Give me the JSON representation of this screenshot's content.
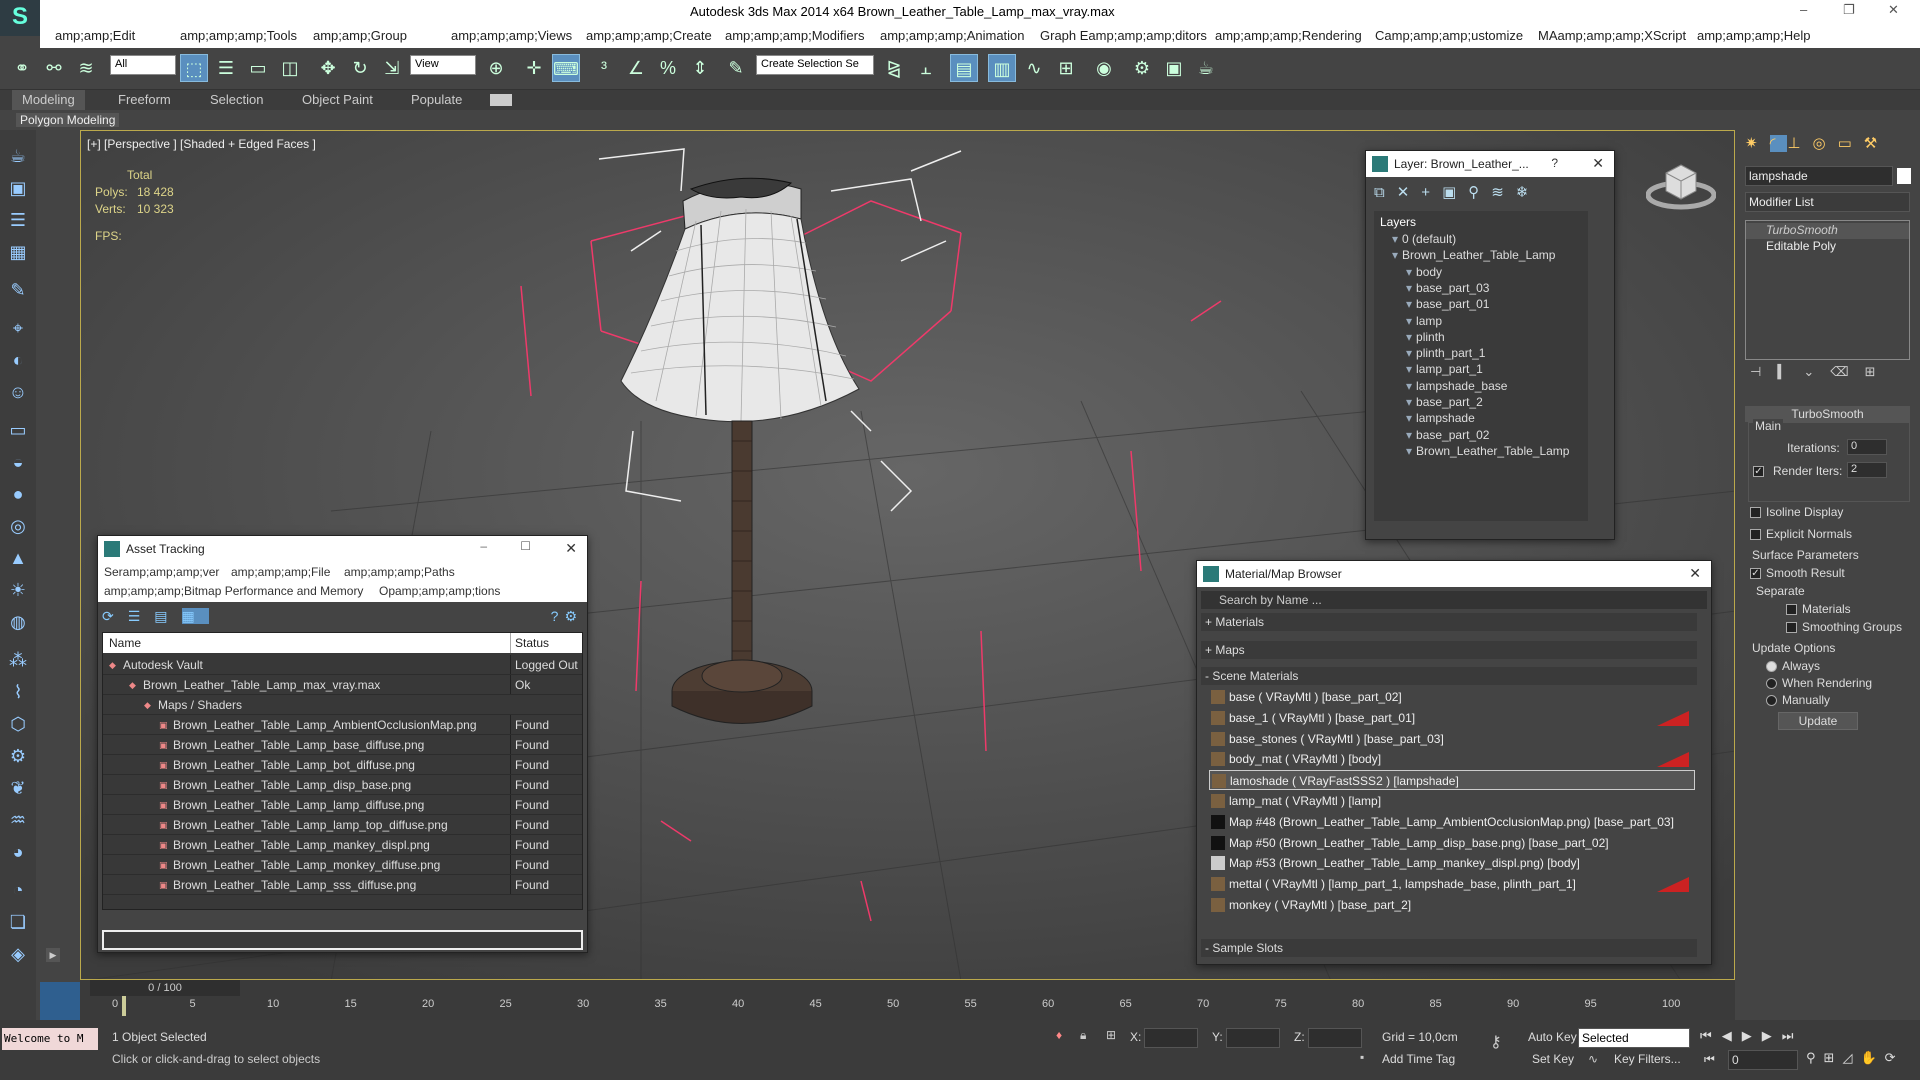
{
  "title": "Autodesk 3ds Max  2014 x64     Brown_Leather_Table_Lamp_max_vray.max",
  "menu": [
    "amp;amp;Edit",
    "amp;amp;amp;Tools",
    "amp;amp;Group",
    "amp;amp;amp;Views",
    "amp;amp;amp;Create",
    "amp;amp;amp;Modifiers",
    "amp;amp;amp;Animation",
    "Graph Eamp;amp;amp;ditors",
    "amp;amp;amp;Rendering",
    "Camp;amp;amp;ustomize",
    "MAamp;amp;amp;XScript",
    "amp;amp;amp;Help"
  ],
  "toolbar": {
    "filter_value": "All",
    "refcoord_value": "View",
    "selection_set_placeholder": "Create Selection Se"
  },
  "ribbon_tabs": [
    "Modeling",
    "Freeform",
    "Selection",
    "Object Paint",
    "Populate"
  ],
  "ribbon_sub": "Polygon Modeling",
  "viewport": {
    "label": "[+] [Perspective ] [Shaded + Edged Faces ]",
    "stats_total": "Total",
    "polys_label": "Polys:",
    "polys_value": "18 428",
    "verts_label": "Verts:",
    "verts_value": "10 323",
    "fps_label": "FPS:"
  },
  "layer_window": {
    "title": "Layer: Brown_Leather_...",
    "help": "?",
    "header": "Layers",
    "items": [
      "0 (default)",
      "Brown_Leather_Table_Lamp",
      "body",
      "base_part_03",
      "base_part_01",
      "lamp",
      "plinth",
      "plinth_part_1",
      "lamp_part_1",
      "lampshade_base",
      "base_part_2",
      "lampshade",
      "base_part_02",
      "Brown_Leather_Table_Lamp"
    ]
  },
  "asset_window": {
    "title": "Asset Tracking",
    "menu": [
      "Seramp;amp;amp;ver",
      "amp;amp;amp;File",
      "amp;amp;amp;Paths",
      "amp;amp;amp;Bitmap Performance and Memory",
      "Opamp;amp;amp;tions"
    ],
    "col_name": "Name",
    "col_status": "Status",
    "rows": [
      {
        "name": "Autodesk Vault",
        "status": "Logged Out ..."
      },
      {
        "name": "Brown_Leather_Table_Lamp_max_vray.max",
        "status": "Ok"
      },
      {
        "name": "Maps / Shaders",
        "status": ""
      },
      {
        "name": "Brown_Leather_Table_Lamp_AmbientOcclusionMap.png",
        "status": "Found"
      },
      {
        "name": "Brown_Leather_Table_Lamp_base_diffuse.png",
        "status": "Found"
      },
      {
        "name": "Brown_Leather_Table_Lamp_bot_diffuse.png",
        "status": "Found"
      },
      {
        "name": "Brown_Leather_Table_Lamp_disp_base.png",
        "status": "Found"
      },
      {
        "name": "Brown_Leather_Table_Lamp_lamp_diffuse.png",
        "status": "Found"
      },
      {
        "name": "Brown_Leather_Table_Lamp_lamp_top_diffuse.png",
        "status": "Found"
      },
      {
        "name": "Brown_Leather_Table_Lamp_mankey_displ.png",
        "status": "Found"
      },
      {
        "name": "Brown_Leather_Table_Lamp_monkey_diffuse.png",
        "status": "Found"
      },
      {
        "name": "Brown_Leather_Table_Lamp_sss_diffuse.png",
        "status": "Found"
      }
    ]
  },
  "material_browser": {
    "title": "Material/Map Browser",
    "search_placeholder": "Search by Name ...",
    "materials_label": "+ Materials",
    "maps_label": "+ Maps",
    "scene_label": "- Scene Materials",
    "sample_label": "- Sample Slots",
    "items": [
      {
        "text": "base  ( VRayMtl ) [base_part_02]",
        "red": false
      },
      {
        "text": "base_1  ( VRayMtl ) [base_part_01]",
        "red": true
      },
      {
        "text": "base_stones  ( VRayMtl ) [base_part_03]",
        "red": false
      },
      {
        "text": "body_mat  ( VRayMtl ) [body]",
        "red": true
      },
      {
        "text": "lamoshade  ( VRayFastSSS2 ) [lampshade]",
        "red": false
      },
      {
        "text": "lamp_mat  ( VRayMtl ) [lamp]",
        "red": false
      },
      {
        "text": "Map #48 (Brown_Leather_Table_Lamp_AmbientOcclusionMap.png) [base_part_03]",
        "red": false
      },
      {
        "text": "Map #50 (Brown_Leather_Table_Lamp_disp_base.png) [base_part_02]",
        "red": false
      },
      {
        "text": "Map #53 (Brown_Leather_Table_Lamp_mankey_displ.png) [body]",
        "red": false
      },
      {
        "text": "mettal  ( VRayMtl ) [lamp_part_1, lampshade_base, plinth_part_1]",
        "red": true
      },
      {
        "text": "monkey  ( VRayMtl ) [base_part_2]",
        "red": false
      }
    ]
  },
  "command_panel": {
    "object_name": "lampshade",
    "modifier_list": "Modifier List",
    "stack": [
      "TurboSmooth",
      "Editable Poly"
    ],
    "rollout": "TurboSmooth",
    "main": "Main",
    "iterations_label": "Iterations:",
    "iterations_value": "0",
    "render_iters_label": "Render Iters:",
    "render_iters_value": "2",
    "isoline": "Isoline Display",
    "explicit": "Explicit Normals",
    "surface": "Surface Parameters",
    "smooth_result": "Smooth Result",
    "separate": "Separate",
    "materials": "Materials",
    "smoothing_groups": "Smoothing Groups",
    "update_options": "Update Options",
    "always": "Always",
    "when_rendering": "When Rendering",
    "manually": "Manually",
    "update_btn": "Update"
  },
  "timeline": {
    "frame": "0 / 100",
    "ticks": [
      "0",
      "5",
      "10",
      "15",
      "20",
      "25",
      "30",
      "35",
      "40",
      "45",
      "50",
      "55",
      "60",
      "65",
      "70",
      "75",
      "80",
      "85",
      "90",
      "95",
      "100"
    ]
  },
  "status": {
    "welcome": "Welcome to M",
    "selected": "1 Object Selected",
    "prompt": "Click or click-and-drag to select objects",
    "x": "X:",
    "y": "Y:",
    "z": "Z:",
    "grid": "Grid = 10,0cm",
    "add_time_tag": "Add Time Tag",
    "auto_key": "Auto Key",
    "auto_key_value": "Selected",
    "set_key": "Set Key",
    "key_filters": "Key Filters...",
    "frame_value": "0"
  },
  "colors": {
    "accent": "#5a8fbf",
    "viewport_border": "#bba94c",
    "stats": "#ddd489",
    "flag_red": "#cc2222"
  }
}
